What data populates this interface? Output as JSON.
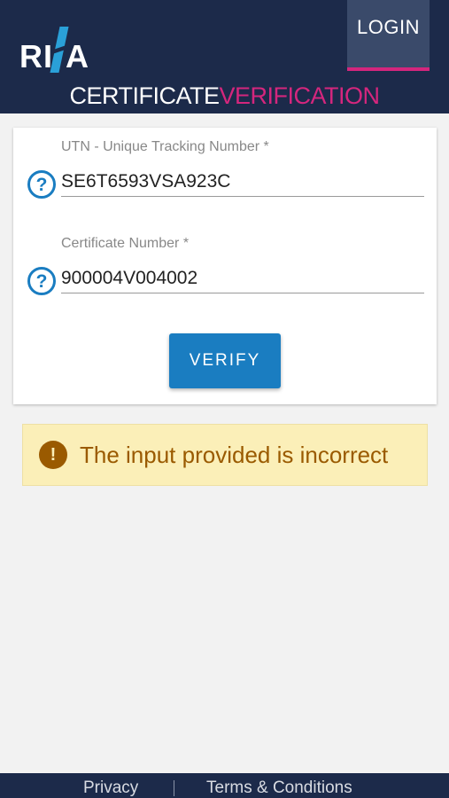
{
  "header": {
    "logo_text": "RINA",
    "logo_left": "RI",
    "logo_right": "A",
    "login_label": "LOGIN",
    "title_part1": "CERTIFICATE",
    "title_part2": "VERIFICATION"
  },
  "form": {
    "utn": {
      "label": "UTN - Unique Tracking Number  *",
      "value": "SE6T6593VSA923C",
      "help_icon": "question-circle-icon",
      "help_glyph": "?"
    },
    "certificate": {
      "label": "Certificate Number  *",
      "value": "900004V004002",
      "help_icon": "question-circle-icon",
      "help_glyph": "?"
    },
    "verify_label": "VERIFY"
  },
  "alert": {
    "icon": "exclamation-circle-icon",
    "icon_glyph": "!",
    "message": "The input provided is incorrect"
  },
  "footer": {
    "privacy_label": "Privacy",
    "terms_label": "Terms & Conditions"
  },
  "colors": {
    "header_bg": "#1c2a4a",
    "accent_magenta": "#d4267d",
    "primary_blue": "#1a7dc1",
    "alert_bg": "#fbefb8",
    "alert_text": "#9a5a00",
    "page_bg": "#f2f2f2"
  }
}
